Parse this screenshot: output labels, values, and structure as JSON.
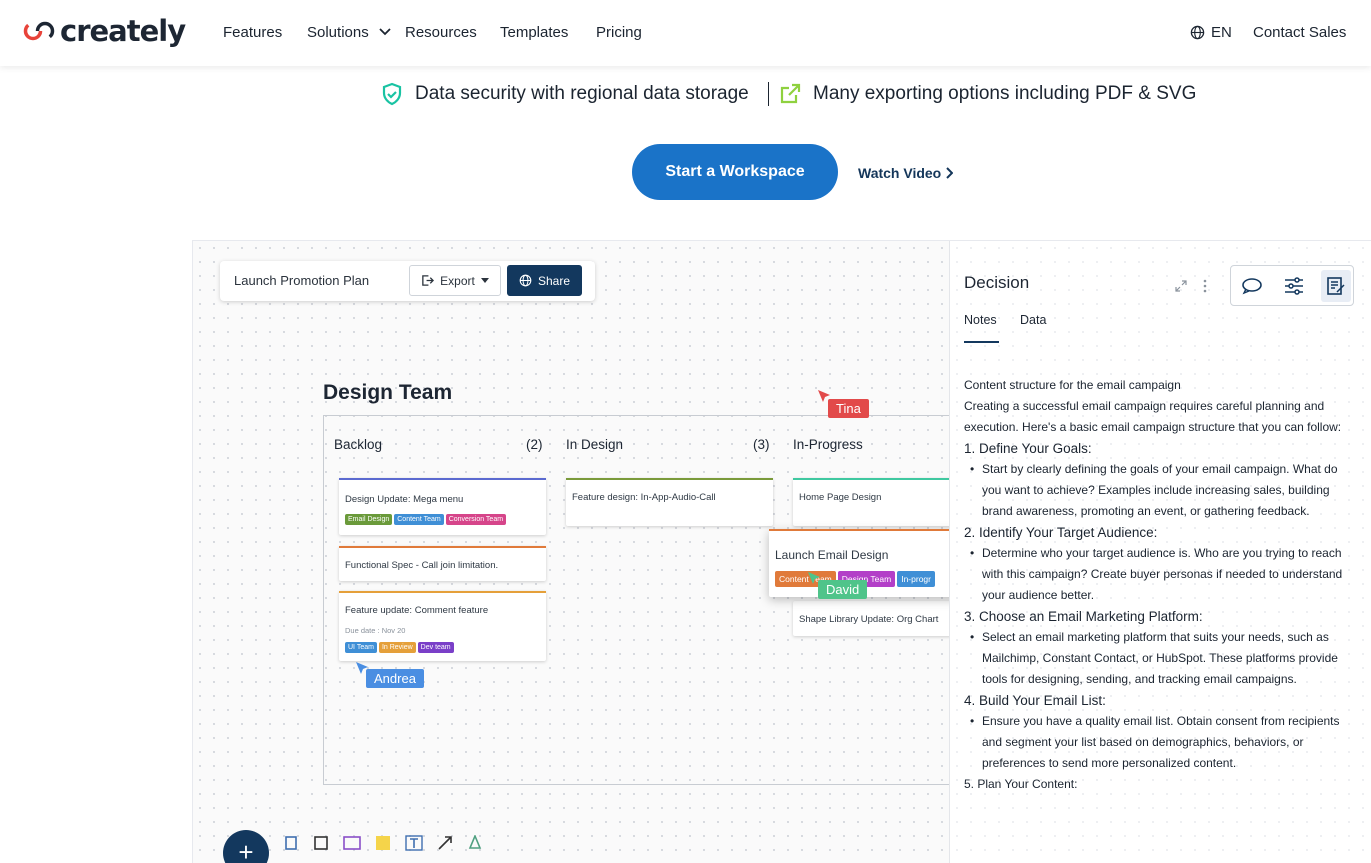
{
  "nav": {
    "logo": "creately",
    "items": [
      "Features",
      "Solutions",
      "Resources",
      "Templates",
      "Pricing"
    ],
    "lang": "EN",
    "contact": "Contact Sales"
  },
  "features": {
    "security": "Data security with regional data storage",
    "export": "Many exporting options including PDF & SVG"
  },
  "cta": {
    "start": "Start a Workspace",
    "watch": "Watch Video"
  },
  "app": {
    "doc_title": "Launch Promotion Plan",
    "export": "Export",
    "share": "Share",
    "board_title": "Design Team",
    "columns": [
      {
        "title": "Backlog",
        "count": "(2)"
      },
      {
        "title": "In Design",
        "count": "(3)"
      },
      {
        "title": "In-Progress",
        "count": ""
      }
    ],
    "cards": {
      "c1": {
        "title": "Design Update: Mega menu",
        "tags": [
          "Email Design",
          "Content Team",
          "Conversion Team"
        ]
      },
      "c2": {
        "title": "Functional Spec - Call join limitation."
      },
      "c3": {
        "title": "Feature update: Comment feature",
        "due": "Due date : Nov 20",
        "tags": [
          "UI Team",
          "In Review",
          "Dev team"
        ]
      },
      "c4": {
        "title": "Feature design: In-App-Audio-Call"
      },
      "c5": {
        "title": "Home Page Design"
      },
      "c6": {
        "title": "Launch Email Design",
        "tags": [
          "Content Team",
          "Design Team",
          "In-progr"
        ]
      },
      "c7": {
        "title": "Shape Library Update: Org Chart"
      }
    },
    "cursors": {
      "tina": "Tina",
      "david": "David",
      "andrea": "Andrea"
    },
    "panel": {
      "title": "Decision",
      "tabs": [
        "Notes",
        "Data"
      ],
      "notes": {
        "p1": "Content structure for the email campaign",
        "p2": "Creating a successful email campaign requires careful planning and execution. Here's a basic email campaign structure that you can follow:",
        "h1": "1. Define Your Goals:",
        "b1": "Start by clearly defining the goals of your email campaign. What do you want to achieve? Examples include increasing sales, building brand awareness, promoting an event, or gathering feedback.",
        "h2": "2. Identify Your Target Audience:",
        "b2": "Determine who your target audience is. Who are you trying to reach with this campaign? Create buyer personas if needed to understand your audience better.",
        "h3": "3. Choose an Email Marketing Platform:",
        "b3": "Select an email marketing platform that suits your needs, such as Mailchimp, Constant Contact, or HubSpot. These platforms provide tools for designing, sending, and tracking email campaigns.",
        "h4": "4. Build Your Email List:",
        "b4": "Ensure you have a quality email list. Obtain consent from recipients and segment your list based on demographics, behaviors, or preferences to send more personalized content.",
        "h5": "5. Plan Your Content:"
      }
    }
  },
  "colors": {
    "primary": "#1a73c8",
    "share": "#13385e",
    "security_icon": "#19c3a3",
    "export_icon": "#8fd13f"
  }
}
